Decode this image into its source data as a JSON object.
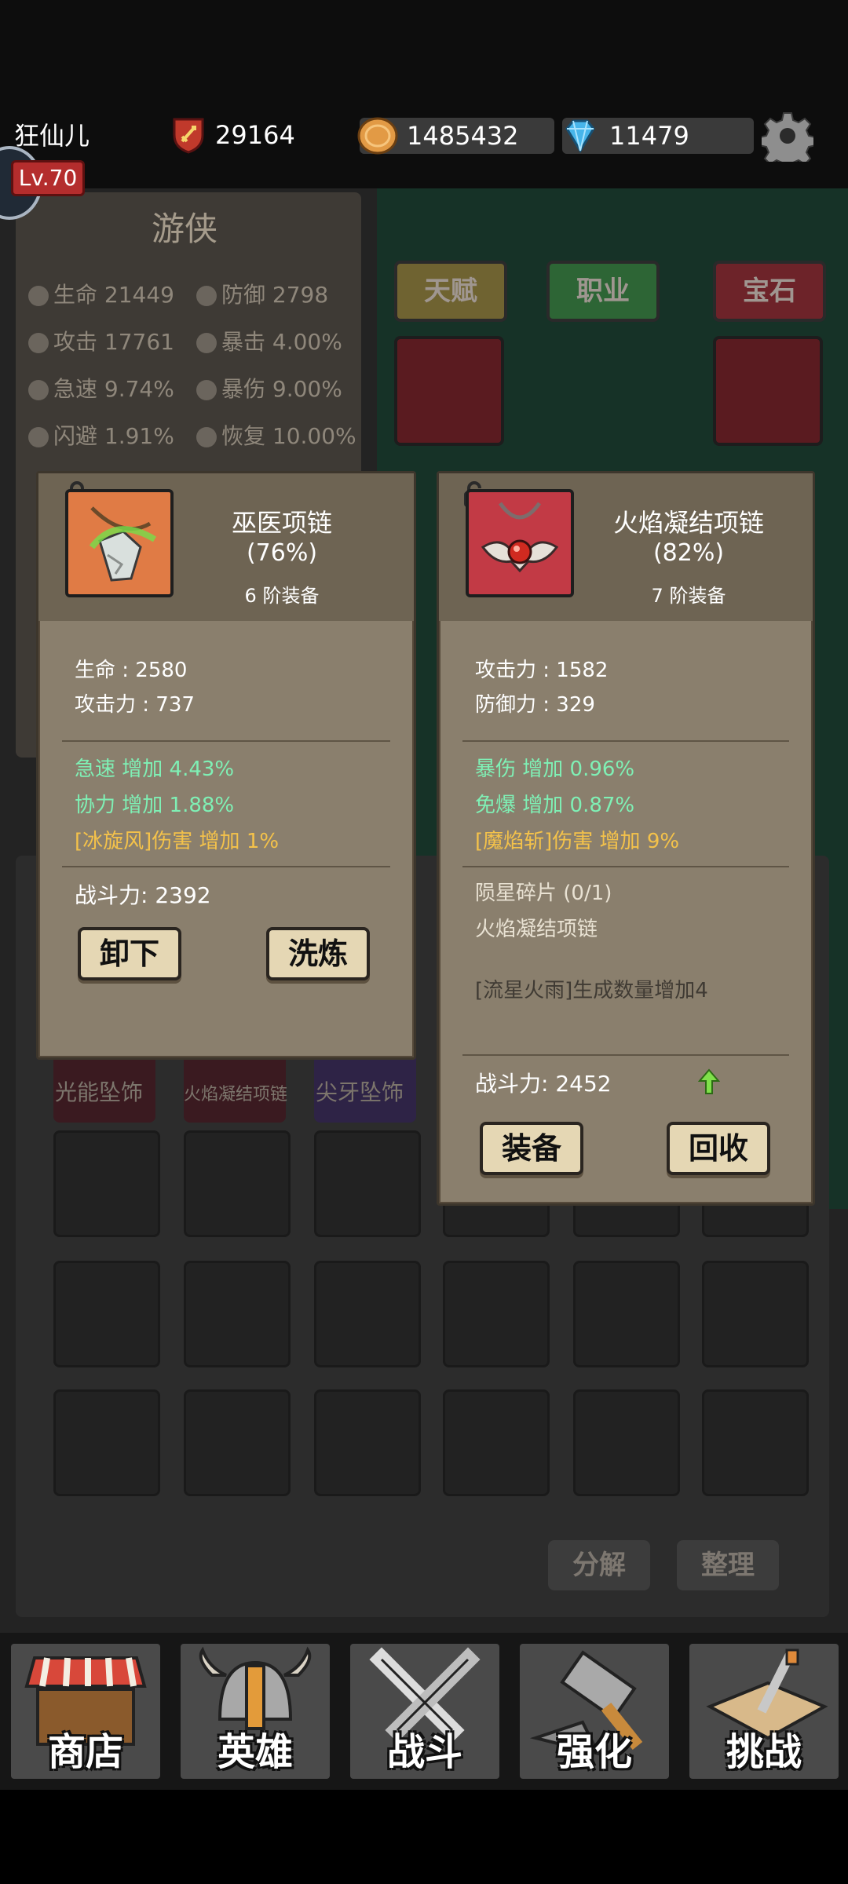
{
  "player": {
    "name": "狂仙儿",
    "level": "Lv.70",
    "power": "29164"
  },
  "resources": {
    "gold": "1485432",
    "gems": "11479"
  },
  "hero_panel": {
    "class_name": "游侠",
    "stats": [
      {
        "label": "生命 21449",
        "icon": "heart-icon"
      },
      {
        "label": "防御 2798",
        "icon": "shield-icon"
      },
      {
        "label": "攻击 17761",
        "icon": "sword-icon"
      },
      {
        "label": "暴击 4.00%",
        "icon": "flame-icon"
      },
      {
        "label": "急速 9.74%",
        "icon": "speed-icon"
      },
      {
        "label": "暴伤 9.00%",
        "icon": "burst-icon"
      },
      {
        "label": "闪避 1.91%",
        "icon": "dodge-icon"
      },
      {
        "label": "恢复 10.00%",
        "icon": "heal-icon"
      }
    ]
  },
  "tabs": {
    "talent": "天赋",
    "class": "职业",
    "gem": "宝石"
  },
  "inventory_labels": [
    "光能坠饰",
    "火焰凝结项链",
    "尖牙坠饰"
  ],
  "inventory_buttons": {
    "decompose": "分解",
    "sort": "整理"
  },
  "equipped_card": {
    "name": "巫医项链",
    "quality": "(76%)",
    "tier": "6 阶装备",
    "base_stats": [
      "生命 : 2580",
      "攻击力 : 737"
    ],
    "bonus_stats": [
      "急速 增加 4.43%",
      "协力 增加 1.88%"
    ],
    "skill_bonus": "[冰旋风]伤害 增加 1%",
    "combat_power": "战斗力: 2392",
    "buttons": {
      "unequip": "卸下",
      "refine": "洗炼"
    }
  },
  "compare_card": {
    "name": "火焰凝结项链",
    "quality": "(82%)",
    "tier": "7 阶装备",
    "base_stats": [
      "攻击力 : 1582",
      "防御力 : 329"
    ],
    "bonus_stats": [
      "暴伤 增加 0.96%",
      "免爆 增加 0.87%"
    ],
    "skill_bonus": "[魔焰斩]伤害 增加 9%",
    "set_name": "陨星碎片 (0/1)",
    "set_piece": "火焰凝结项链",
    "set_effect": "[流星火雨]生成数量增加4",
    "combat_power": "战斗力: 2452",
    "buttons": {
      "equip": "装备",
      "recycle": "回收"
    }
  },
  "bottom_nav": [
    "商店",
    "英雄",
    "战斗",
    "强化",
    "挑战"
  ],
  "colors": {
    "bonus_green": "#7ff0b5",
    "skill_orange": "#f4c24a",
    "card_bg": "#8a7f6d",
    "button_bg": "#e5d7b4"
  }
}
